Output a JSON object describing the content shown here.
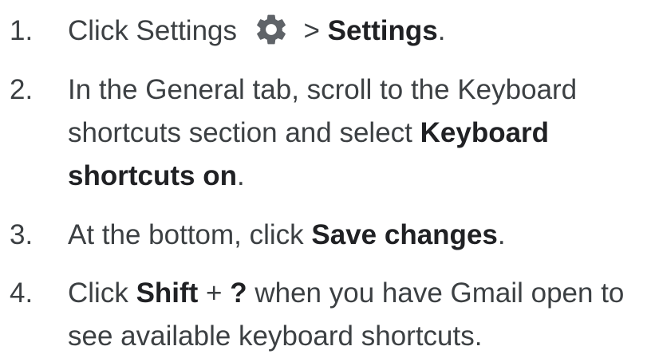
{
  "steps": [
    {
      "number": "1.",
      "parts": {
        "t1": "Click Settings ",
        "icon": "gear-icon",
        "t2": " > ",
        "b1": "Settings",
        "t3": "."
      }
    },
    {
      "number": "2.",
      "parts": {
        "t1": "In the General tab, scroll to the Keyboard shortcuts section and select ",
        "b1": "Keyboard shortcuts on",
        "t2": "."
      }
    },
    {
      "number": "3.",
      "parts": {
        "t1": "At the bottom, click ",
        "b1": "Save changes",
        "t2": "."
      }
    },
    {
      "number": "4.",
      "parts": {
        "t1": "Click ",
        "b1": "Shift",
        "t2": " + ",
        "b2": "?",
        "t3": " when you have Gmail open to see available keyboard shortcuts."
      }
    }
  ],
  "colors": {
    "text": "#3c4043",
    "bold": "#202124",
    "icon": "#5f6368"
  }
}
